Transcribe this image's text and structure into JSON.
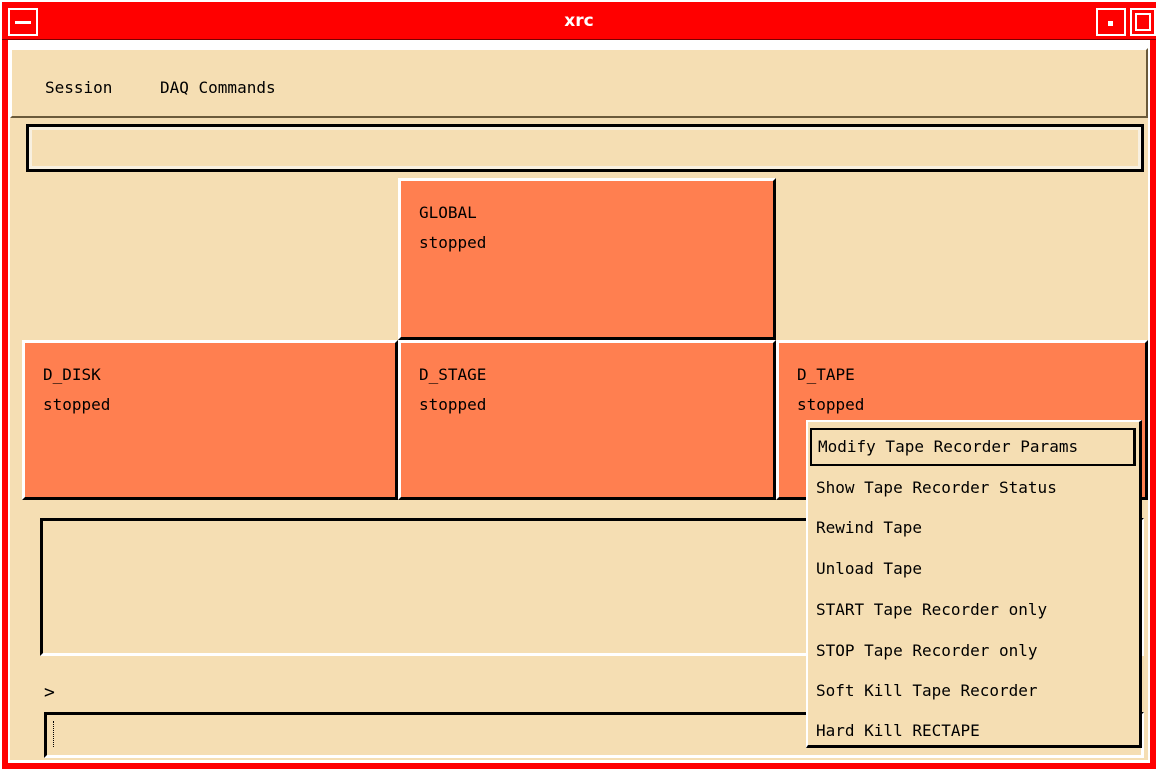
{
  "window": {
    "title": "xrc"
  },
  "menubar": {
    "items": [
      "Session",
      "DAQ Commands"
    ]
  },
  "tiles": {
    "global": {
      "name": "GLOBAL",
      "state": "stopped"
    },
    "d_disk": {
      "name": "D_DISK",
      "state": "stopped"
    },
    "d_stage": {
      "name": "D_STAGE",
      "state": "stopped"
    },
    "d_tape": {
      "name": "D_TAPE",
      "state": "stopped"
    }
  },
  "console": {
    "prompt": ">"
  },
  "popup_menu": {
    "items": [
      "Modify Tape Recorder Params",
      "Show Tape Recorder Status",
      "Rewind Tape",
      "Unload Tape",
      "START Tape Recorder only",
      "STOP Tape Recorder only",
      "Soft Kill Tape Recorder",
      "Hard Kill RECTAPE"
    ],
    "highlighted_index": 0
  },
  "colors": {
    "titlebar": "#ff0000",
    "background": "#f5deb3",
    "tile_stopped": "#ff7f50"
  },
  "icons": [
    "window-menu-icon",
    "minimize-icon",
    "maximize-icon"
  ]
}
